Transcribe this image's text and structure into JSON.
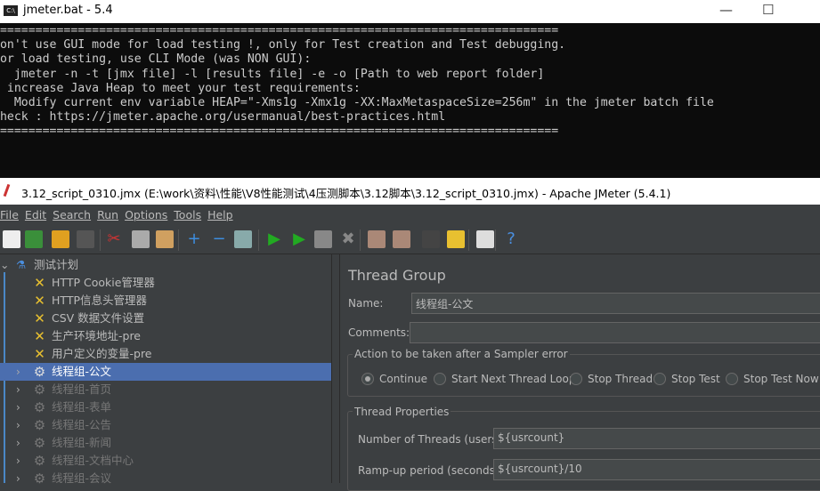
{
  "console_window": {
    "title": "jmeter.bat - 5.4",
    "icon": "cmd-icon",
    "lines": [
      "================================================================================",
      "Don't use GUI mode for load testing !, only for Test creation and Test debugging.",
      "For load testing, use CLI Mode (was NON GUI):",
      "   jmeter -n -t [jmx file] -l [results file] -e -o [Path to web report folder]",
      "& increase Java Heap to meet your test requirements:",
      "   Modify current env variable HEAP=\"-Xms1g -Xmx1g -XX:MaxMetaspaceSize=256m\" in the jmeter batch file",
      "Check : https://jmeter.apache.org/usermanual/best-practices.html",
      "================================================================================"
    ]
  },
  "jmeter_window": {
    "title": "3.12_script_0310.jmx (E:\\work\\资料\\性能\\V8性能测试\\4压测脚本\\3.12脚本\\3.12_script_0310.jmx) - Apache JMeter (5.4.1)"
  },
  "menu": [
    "File",
    "Edit",
    "Search",
    "Run",
    "Options",
    "Tools",
    "Help"
  ],
  "toolbar": [
    "new",
    "templates",
    "open",
    "save",
    "cut",
    "copy",
    "paste",
    "expand",
    "collapse",
    "toggle",
    "start",
    "start-no-pauses",
    "stop",
    "shutdown",
    "clear",
    "clear-all",
    "search",
    "reset-search",
    "function-helper",
    "help"
  ],
  "tree": {
    "root": "测试计划",
    "items": [
      {
        "label": "HTTP Cookie管理器",
        "type": "config"
      },
      {
        "label": "HTTP信息头管理器",
        "type": "config"
      },
      {
        "label": "CSV 数据文件设置",
        "type": "config"
      },
      {
        "label": "生产环境地址-pre",
        "type": "config"
      },
      {
        "label": "用户定义的变量-pre",
        "type": "config"
      },
      {
        "label": "线程组-公文",
        "type": "thread",
        "selected": true
      },
      {
        "label": "线程组-首页",
        "type": "thread",
        "disabled": true
      },
      {
        "label": "线程组-表单",
        "type": "thread",
        "disabled": true
      },
      {
        "label": "线程组-公告",
        "type": "thread",
        "disabled": true
      },
      {
        "label": "线程组-新闻",
        "type": "thread",
        "disabled": true
      },
      {
        "label": "线程组-文档中心",
        "type": "thread",
        "disabled": true
      },
      {
        "label": "线程组-会议",
        "type": "thread",
        "disabled": true
      }
    ]
  },
  "panel": {
    "title": "Thread Group",
    "name_label": "Name:",
    "name_value": "线程组-公文",
    "comments_label": "Comments:",
    "comments_value": "",
    "action_legend": "Action to be taken after a Sampler error",
    "actions": [
      "Continue",
      "Start Next Thread Loop",
      "Stop Thread",
      "Stop Test",
      "Stop Test Now"
    ],
    "selected_action": "Continue",
    "thread_props_legend": "Thread Properties",
    "threads_label": "Number of Threads (users):",
    "threads_value": "${usrcount}",
    "rampup_label": "Ramp-up period (seconds):",
    "rampup_value": "${usrcount}/10"
  }
}
